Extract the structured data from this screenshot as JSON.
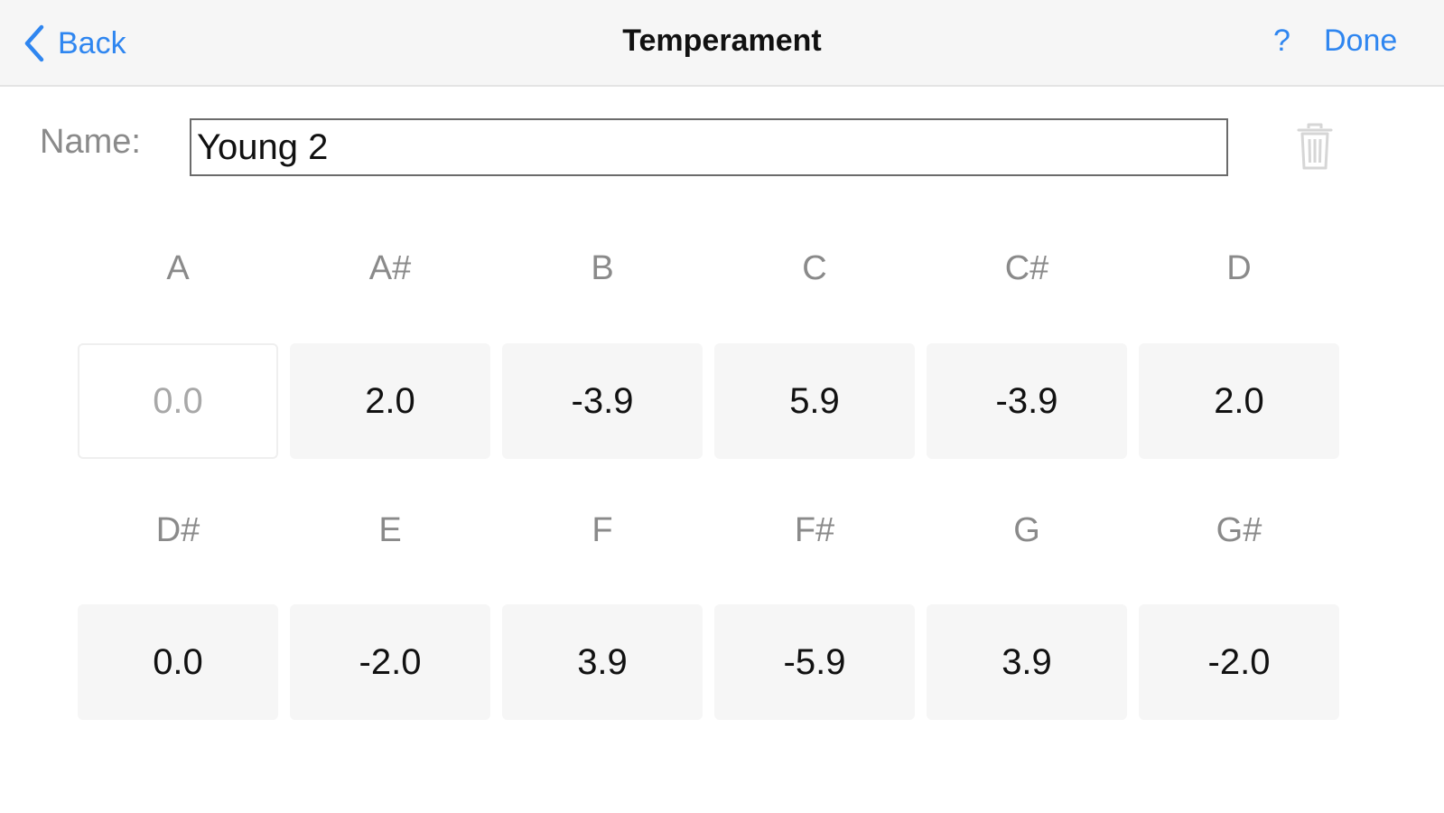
{
  "navbar": {
    "back_label": "Back",
    "title": "Temperament",
    "help_label": "?",
    "done_label": "Done"
  },
  "name": {
    "label": "Name:",
    "value": "Young 2"
  },
  "notes": [
    {
      "note": "A",
      "offset": "0.0",
      "editable": false
    },
    {
      "note": "A#",
      "offset": "2.0",
      "editable": true
    },
    {
      "note": "B",
      "offset": "-3.9",
      "editable": true
    },
    {
      "note": "C",
      "offset": "5.9",
      "editable": true
    },
    {
      "note": "C#",
      "offset": "-3.9",
      "editable": true
    },
    {
      "note": "D",
      "offset": "2.0",
      "editable": true
    },
    {
      "note": "D#",
      "offset": "0.0",
      "editable": true
    },
    {
      "note": "E",
      "offset": "-2.0",
      "editable": true
    },
    {
      "note": "F",
      "offset": "3.9",
      "editable": true
    },
    {
      "note": "F#",
      "offset": "-5.9",
      "editable": true
    },
    {
      "note": "G",
      "offset": "3.9",
      "editable": true
    },
    {
      "note": "G#",
      "offset": "-2.0",
      "editable": true
    }
  ],
  "colors": {
    "accent": "#2f86f0",
    "navbar_bg": "#f6f6f6",
    "cell_bg": "#f6f6f6",
    "label_gray": "#8a8a8a",
    "disabled_text": "#a8a8a8"
  },
  "icons": {
    "back": "chevron-left-icon",
    "delete": "trash-icon"
  }
}
